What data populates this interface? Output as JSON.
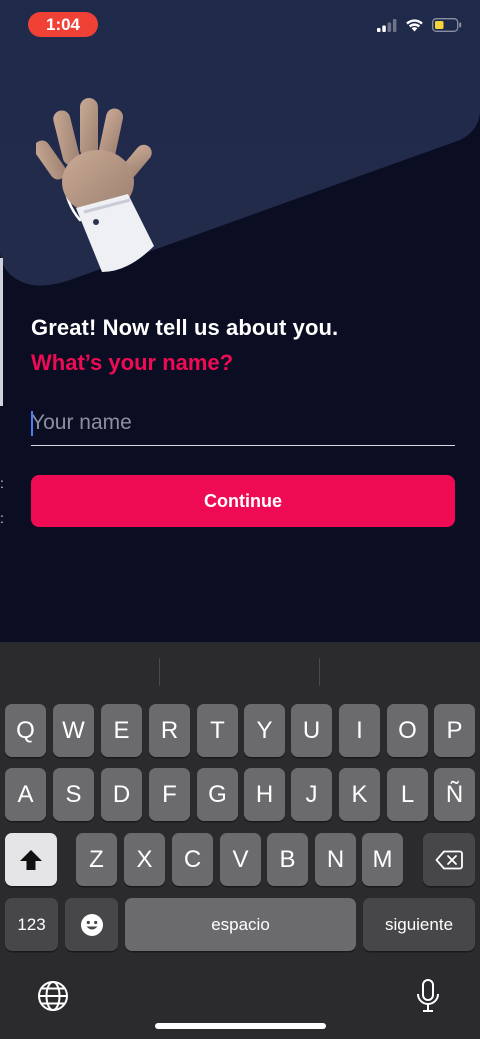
{
  "status_bar": {
    "time": "1:04"
  },
  "onboarding": {
    "headline": "Great! Now tell us about you.",
    "question": "What’s your name?",
    "name_placeholder": "Your name",
    "name_value": "",
    "continue_label": "Continue"
  },
  "keyboard": {
    "row1": [
      "Q",
      "W",
      "E",
      "R",
      "T",
      "Y",
      "U",
      "I",
      "O",
      "P"
    ],
    "row2": [
      "A",
      "S",
      "D",
      "F",
      "G",
      "H",
      "J",
      "K",
      "L",
      "Ñ"
    ],
    "row3": [
      "Z",
      "X",
      "C",
      "V",
      "B",
      "N",
      "M"
    ],
    "numbers_label": "123",
    "space_label": "espacio",
    "return_label": "siguiente"
  },
  "colors": {
    "background": "#0b0e22",
    "panel": "#222a48",
    "accent": "#ef0b54",
    "time_pill": "#ef4136",
    "keyboard": "#2b2b2d"
  },
  "icons": {
    "shift": "shift-arrow-icon",
    "delete": "backspace-icon",
    "emoji": "emoji-face-icon",
    "globe": "globe-icon",
    "mic": "microphone-icon"
  }
}
